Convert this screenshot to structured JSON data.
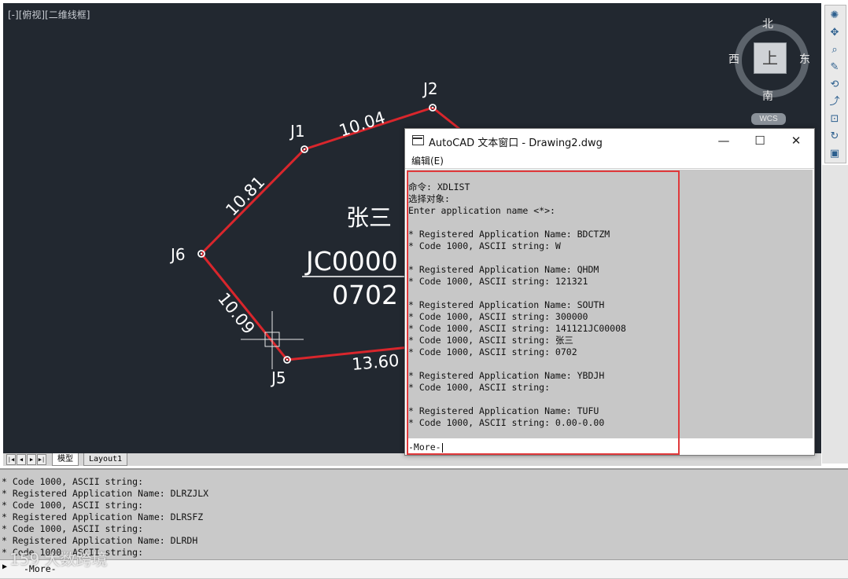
{
  "viewport": {
    "label": "[-][俯视][二维线框]"
  },
  "drawing": {
    "line_color": "#d9262c",
    "points": [
      {
        "name": "J1"
      },
      {
        "name": "J2"
      },
      {
        "name": "J5"
      },
      {
        "name": "J6"
      }
    ],
    "distances": [
      "10.04",
      "10.81",
      "10.09",
      "13.60"
    ],
    "owner_name": "张三",
    "parcel_code": "JC0000",
    "parcel_number": "0702"
  },
  "viewcube": {
    "north": "北",
    "south": "南",
    "west": "西",
    "east": "东",
    "top": "上",
    "wcs": "WCS"
  },
  "tabs": {
    "model": "模型",
    "layout1": "Layout1"
  },
  "text_window": {
    "title": "AutoCAD 文本窗口 - Drawing2.dwg",
    "menu_edit": "编辑(E)",
    "lines": [
      "命令: XDLIST",
      "选择对象:",
      "Enter application name <*>:",
      "",
      "* Registered Application Name: BDCTZM",
      "* Code 1000, ASCII string: W",
      "",
      "* Registered Application Name: QHDM",
      "* Code 1000, ASCII string: 121321",
      "",
      "* Registered Application Name: SOUTH",
      "* Code 1000, ASCII string: 300000",
      "* Code 1000, ASCII string: 141121JC00008",
      "* Code 1000, ASCII string: 张三",
      "* Code 1000, ASCII string: 0702",
      "",
      "* Registered Application Name: YBDJH",
      "* Code 1000, ASCII string:",
      "",
      "* Registered Application Name: TUFU",
      "* Code 1000, ASCII string: 0.00-0.00"
    ],
    "prompt": "-More-",
    "highlight_color": "#e0393b"
  },
  "command_bottom": {
    "lines": [
      "* Code 1000, ASCII string:",
      "* Registered Application Name: DLRZJLX",
      "* Code 1000, ASCII string:",
      "* Registered Application Name: DLRSFZ",
      "* Code 1000, ASCII string:",
      "* Registered Application Name: DLRDH",
      "* Code 1000, ASCII string:"
    ],
    "prompt": "-More-"
  },
  "watermark": "159 大数跨境"
}
